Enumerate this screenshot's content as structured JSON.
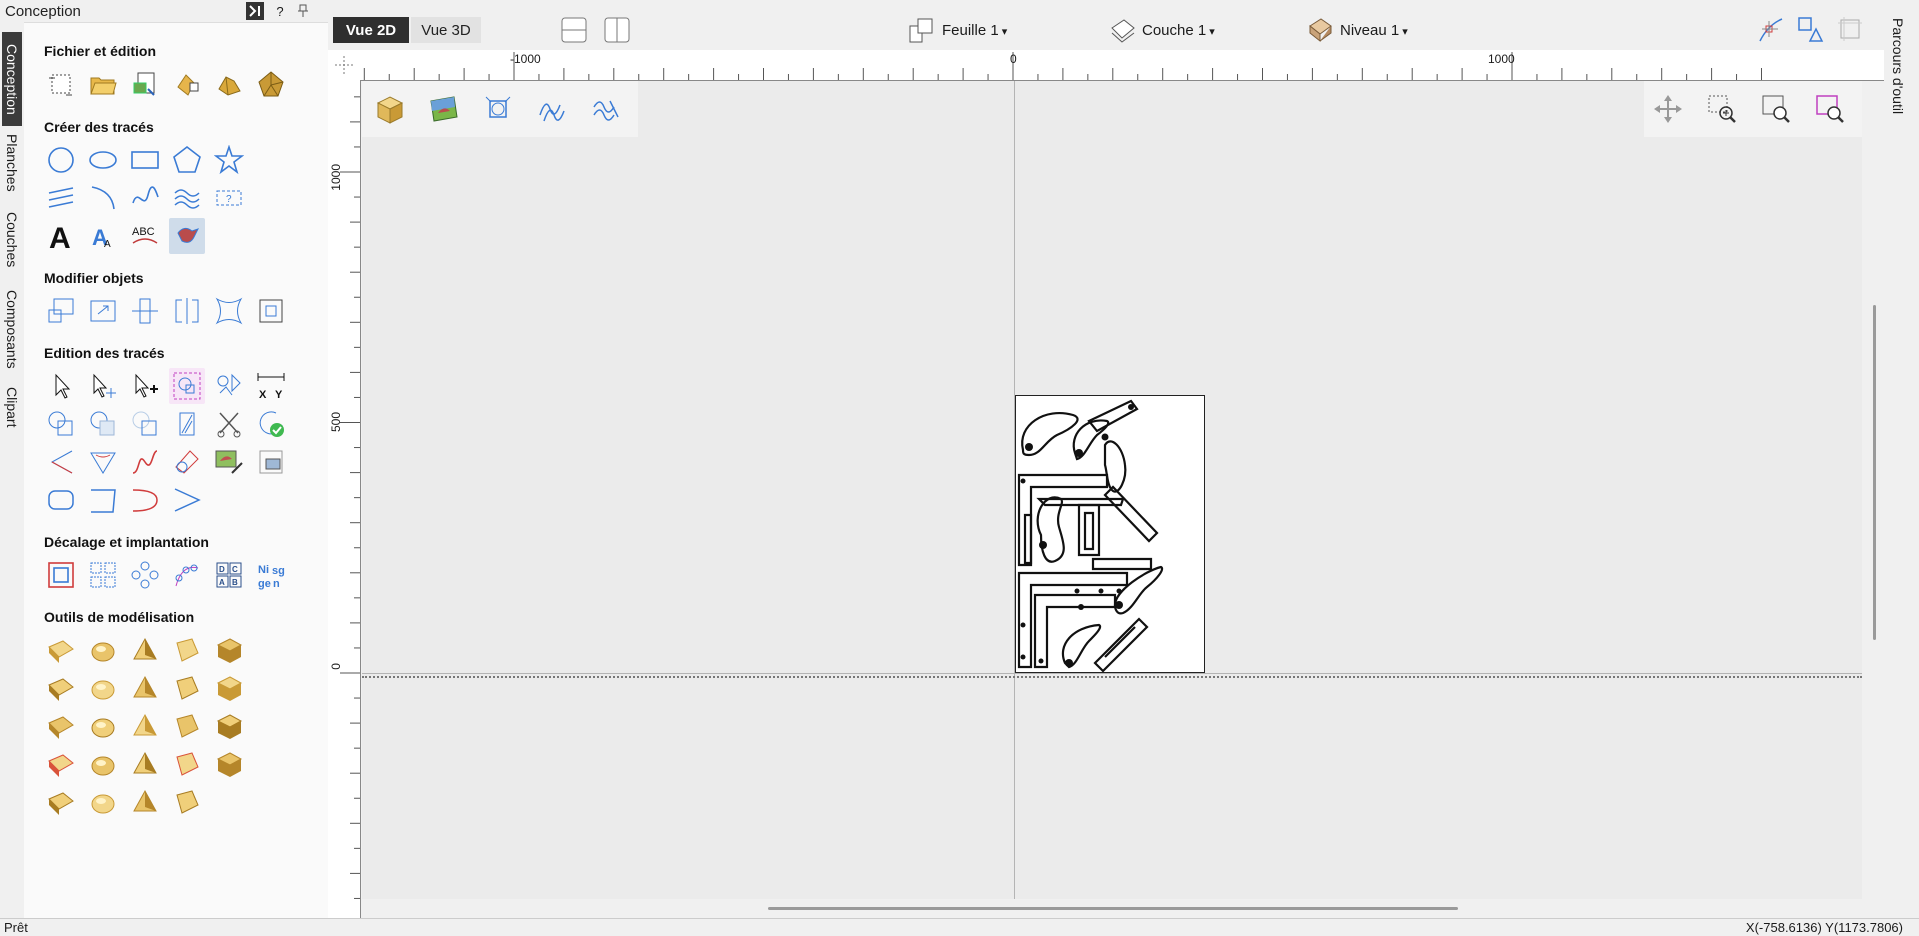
{
  "left_tabs": [
    "Conception",
    "Planches",
    "Couches",
    "Composants",
    "Clipart"
  ],
  "panel": {
    "title": "Conception",
    "help_label": "?",
    "sections": [
      {
        "title": "Fichier et édition",
        "tools": [
          "create-new-job-icon",
          "open-file-icon",
          "import-vectors-icon",
          "job-setup-icon",
          "import-component-icon",
          "import-model-icon"
        ]
      },
      {
        "title": "Créer des tracés",
        "tools": [
          "circle-icon",
          "ellipse-icon",
          "rectangle-icon",
          "polygon-icon",
          "star-icon",
          "polyline-icon",
          "arc-icon",
          "curve-icon",
          "wave-pattern-icon",
          "dimension-icon",
          "text-icon",
          "auto-layout-text-icon",
          "text-on-curve-icon",
          "bitmap-trace-icon"
        ]
      },
      {
        "title": "Modifier objets",
        "tools": [
          "scale-icon",
          "resize-icon",
          "align-center-icon",
          "mirror-icon",
          "distort-icon",
          "align-icon"
        ]
      },
      {
        "title": "Edition des tracés",
        "tools": [
          "select-icon",
          "node-edit-icon",
          "transform-icon",
          "group-icon",
          "ungroup-icon",
          "measure-xy-icon",
          "weld-icon",
          "subtract-icon",
          "intersect-icon",
          "trim-icon",
          "scissors-icon",
          "close-vector-icon",
          "join-icon",
          "fillet-icon",
          "smooth-icon",
          "offset-icon",
          "bitmap-edit-icon",
          "bitmap-resize-icon",
          "rounded-rect-icon",
          "bevel-icon",
          "curve-fit-icon",
          "chevron-join-icon"
        ]
      },
      {
        "title": "Décalage et implantation",
        "tools": [
          "offset-vector-icon",
          "array-copy-icon",
          "circular-copy-icon",
          "copy-along-path-icon",
          "nesting-icon",
          "nest-letters-icon"
        ]
      },
      {
        "title": "Outils de modélisation",
        "tools": [
          "flat-surface-icon",
          "dome-icon",
          "pyramid-icon",
          "extrude-icon",
          "box-3d-icon",
          "cylinder-icon",
          "spin-icon",
          "key-icon",
          "twist-icon",
          "hand-sculpt-icon",
          "texture-icon",
          "weave-icon",
          "clip-icon",
          "slice-icon",
          "stack-icon",
          "red-cube-icon",
          "cut-icon",
          "flame-icon",
          "merge-icon",
          "waves-icon",
          "relief-icon",
          "smooth-block-icon",
          "cube-open-icon",
          "cube-closed-icon"
        ]
      }
    ]
  },
  "top_bar": {
    "view_2d": "Vue 2D",
    "view_3d": "Vue 3D",
    "sheet": "Feuille 1",
    "layer": "Couche 1",
    "level": "Niveau 1"
  },
  "rulers": {
    "horizontal_labels": [
      "-1000",
      "0",
      "1000"
    ],
    "vertical_labels": [
      "1000",
      "500",
      "0"
    ]
  },
  "right_tab": "Parcours d'outil",
  "status": {
    "left": "Prêt",
    "coords": "X(-758.6136) Y(1173.7806)"
  }
}
